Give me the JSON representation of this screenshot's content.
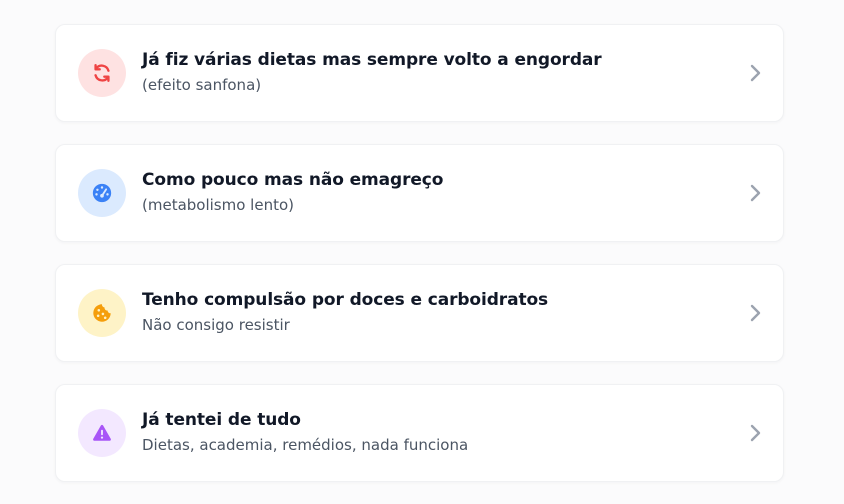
{
  "cards": [
    {
      "title": "Já fiz várias dietas mas sempre volto a engordar",
      "subtitle": "(efeito sanfona)",
      "icon": "refresh-icon",
      "icon_color": "#ef4444",
      "icon_bg": "#fee2e2"
    },
    {
      "title": "Como pouco mas não emagreço",
      "subtitle": "(metabolismo lento)",
      "icon": "gauge-icon",
      "icon_color": "#3b82f6",
      "icon_bg": "#dbeafe"
    },
    {
      "title": "Tenho compulsão por doces e carboidratos",
      "subtitle": "Não consigo resistir",
      "icon": "cookie-icon",
      "icon_color": "#f59e0b",
      "icon_bg": "#fef3c7"
    },
    {
      "title": "Já tentei de tudo",
      "subtitle": "Dietas, academia, remédios, nada funciona",
      "icon": "warning-icon",
      "icon_color": "#a855f7",
      "icon_bg": "#f3e8ff"
    }
  ],
  "chevron_color": "#9ca3af"
}
